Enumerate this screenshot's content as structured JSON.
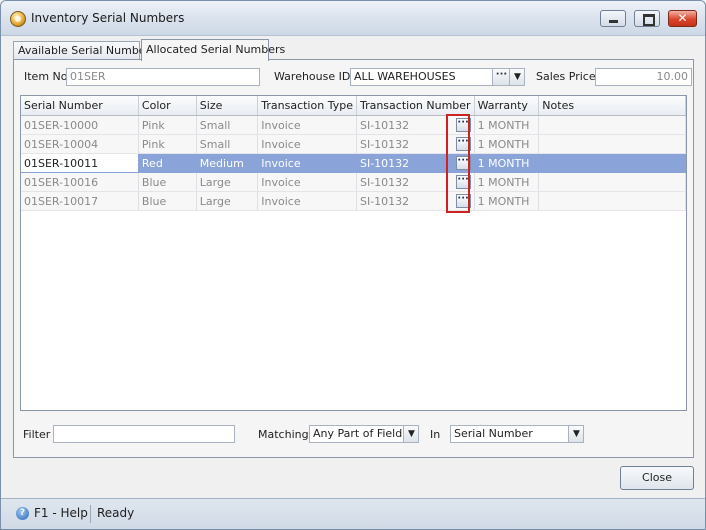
{
  "window": {
    "title": "Inventory Serial Numbers"
  },
  "tabs": [
    {
      "label": "Available Serial Numbers"
    },
    {
      "label": "Allocated Serial Numbers"
    }
  ],
  "header": {
    "item_no_label": "Item No",
    "item_no_value": "01SER",
    "warehouse_label": "Warehouse ID",
    "warehouse_value": "ALL WAREHOUSES",
    "sales_price_label": "Sales Price",
    "sales_price_value": "10.00"
  },
  "grid": {
    "columns": [
      "Serial Number",
      "Color",
      "Size",
      "Transaction Type",
      "Transaction Number",
      "Warranty",
      "Notes"
    ],
    "rows": [
      {
        "serial": "01SER-10000",
        "color": "Pink",
        "size": "Small",
        "txn_type": "Invoice",
        "txn_number": "SI-10132",
        "warranty": "1 MONTH",
        "notes": ""
      },
      {
        "serial": "01SER-10004",
        "color": "Pink",
        "size": "Small",
        "txn_type": "Invoice",
        "txn_number": "SI-10132",
        "warranty": "1 MONTH",
        "notes": ""
      },
      {
        "serial": "01SER-10011",
        "color": "Red",
        "size": "Medium",
        "txn_type": "Invoice",
        "txn_number": "SI-10132",
        "warranty": "1 MONTH",
        "notes": ""
      },
      {
        "serial": "01SER-10016",
        "color": "Blue",
        "size": "Large",
        "txn_type": "Invoice",
        "txn_number": "SI-10132",
        "warranty": "1 MONTH",
        "notes": ""
      },
      {
        "serial": "01SER-10017",
        "color": "Blue",
        "size": "Large",
        "txn_type": "Invoice",
        "txn_number": "SI-10132",
        "warranty": "1 MONTH",
        "notes": ""
      }
    ],
    "selected_row": 2,
    "row_button_icon": "ellipsis-icon"
  },
  "filter": {
    "filter_label": "Filter",
    "filter_value": "",
    "matching_label": "Matching",
    "matching_value": "Any Part of Field",
    "in_label": "In",
    "in_value": "Serial Number"
  },
  "buttons": {
    "close_label": "Close"
  },
  "status": {
    "help_label": "F1 - Help",
    "state": "Ready"
  },
  "colors": {
    "selection": "#8aa3d8",
    "highlight_box": "#cc2222"
  }
}
